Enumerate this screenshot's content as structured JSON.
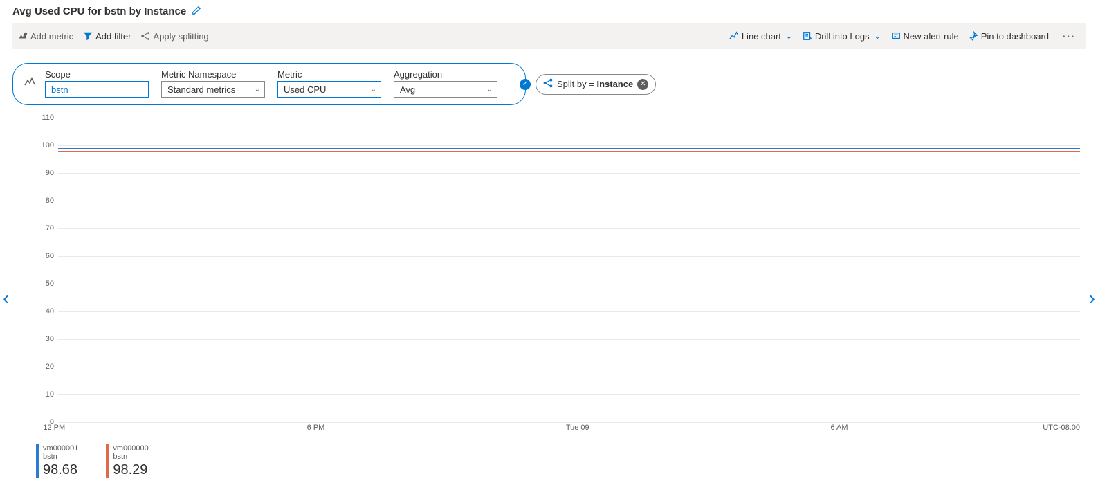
{
  "title": "Avg Used CPU for bstn by Instance",
  "toolbar_left": {
    "add_metric": "Add metric",
    "add_filter": "Add filter",
    "apply_split": "Apply splitting"
  },
  "toolbar_right": {
    "line_chart": "Line chart",
    "drill_logs": "Drill into Logs",
    "new_alert": "New alert rule",
    "pin_dash": "Pin to dashboard"
  },
  "query": {
    "scope_label": "Scope",
    "scope_value": "bstn",
    "ns_label": "Metric Namespace",
    "ns_value": "Standard metrics",
    "metric_label": "Metric",
    "metric_value": "Used CPU",
    "agg_label": "Aggregation",
    "agg_value": "Avg"
  },
  "split": {
    "prefix": "Split by = ",
    "value": "Instance"
  },
  "yticks": [
    "0",
    "10",
    "20",
    "30",
    "40",
    "50",
    "60",
    "70",
    "80",
    "90",
    "100",
    "110"
  ],
  "xticks": [
    "12 PM",
    "6 PM",
    "Tue 09",
    "6 AM"
  ],
  "timezone": "UTC-08:00",
  "legend": [
    {
      "name": "vm000001",
      "sub": "bstn",
      "value": "98.68",
      "color": "#2a7cd1"
    },
    {
      "name": "vm000000",
      "sub": "bstn",
      "value": "98.29",
      "color": "#e0694a"
    }
  ],
  "chart_data": {
    "type": "line",
    "title": "Avg Used CPU for bstn by Instance",
    "xlabel": "",
    "ylabel": "",
    "ylim": [
      0,
      110
    ],
    "x": [
      "12 PM",
      "1 PM",
      "2 PM",
      "3 PM",
      "4 PM",
      "5 PM",
      "6 PM",
      "7 PM",
      "8 PM",
      "9 PM",
      "10 PM",
      "11 PM",
      "Tue 09",
      "1 AM",
      "2 AM",
      "3 AM",
      "4 AM",
      "5 AM",
      "6 AM",
      "7 AM",
      "8 AM",
      "9 AM",
      "10 AM",
      "11 AM"
    ],
    "series": [
      {
        "name": "vm000001 bstn",
        "color": "#2a7cd1",
        "values": [
          99,
          99,
          98,
          99,
          99,
          99,
          99,
          99,
          99,
          99,
          99,
          99,
          99,
          98,
          99,
          99,
          99,
          99,
          99,
          99,
          99,
          99,
          99,
          99
        ]
      },
      {
        "name": "vm000000 bstn",
        "color": "#e0694a",
        "values": [
          98,
          98,
          97,
          98,
          98,
          98,
          98,
          98,
          98,
          98,
          98,
          98,
          98,
          98,
          98,
          98,
          98,
          98,
          98,
          98,
          98,
          98,
          98,
          98
        ]
      }
    ]
  }
}
